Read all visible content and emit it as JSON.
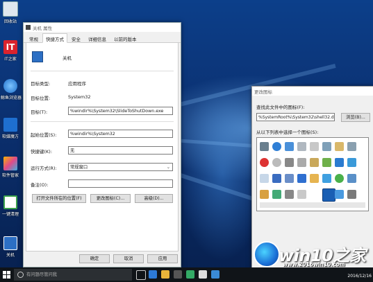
{
  "desktop": {
    "icons": [
      {
        "label": "回收站",
        "color": "#dfe7ef"
      },
      {
        "label": "IT之家",
        "color": "#d9232d"
      },
      {
        "label": "鲸鱼浏览器",
        "color": "#3b8fe0"
      },
      {
        "label": "软媒魔方",
        "color": "#1e6fd0"
      },
      {
        "label": "软件管家",
        "color": "#e04a8a"
      },
      {
        "label": "一键清理",
        "color": "#3aa14b"
      },
      {
        "label": "关机",
        "color": "#2c6fc4"
      }
    ]
  },
  "properties": {
    "title": "关机 属性",
    "tabs": [
      "常规",
      "快捷方式",
      "安全",
      "详细信息",
      "以前的版本"
    ],
    "active_tab": "快捷方式",
    "name": "关机",
    "target_type_label": "目标类型:",
    "target_type": "应用程序",
    "target_location_label": "目标位置:",
    "target_location": "System32",
    "target_label": "目标(T):",
    "target": "%windir%\\System32\\SlideToShutDown.exe",
    "start_in_label": "起始位置(S):",
    "start_in": "%windir%\\System32",
    "hotkey_label": "快捷键(K):",
    "hotkey": "无",
    "run_label": "运行方式(R):",
    "run": "常规窗口",
    "comment_label": "备注(O):",
    "comment": "",
    "btn_open_location": "打开文件所在的位置(F)",
    "btn_change_icon": "更改图标(C)...",
    "btn_advanced": "高级(D)...",
    "btn_ok": "确定",
    "btn_cancel": "取消",
    "btn_apply": "应用"
  },
  "change_icon": {
    "title": "更改图标",
    "search_label": "查找此文件中的图标(F):",
    "path": "%SystemRoot%\\System32\\shell32.d",
    "browse": "浏览(B)...",
    "list_label": "从以下列表中选择一个图标(S):"
  },
  "taskbar": {
    "search_placeholder": "有问题尽管问我",
    "clock": "2016/12/16"
  },
  "watermark": {
    "brand": "win10之家",
    "url": "www.2016win10.com"
  }
}
